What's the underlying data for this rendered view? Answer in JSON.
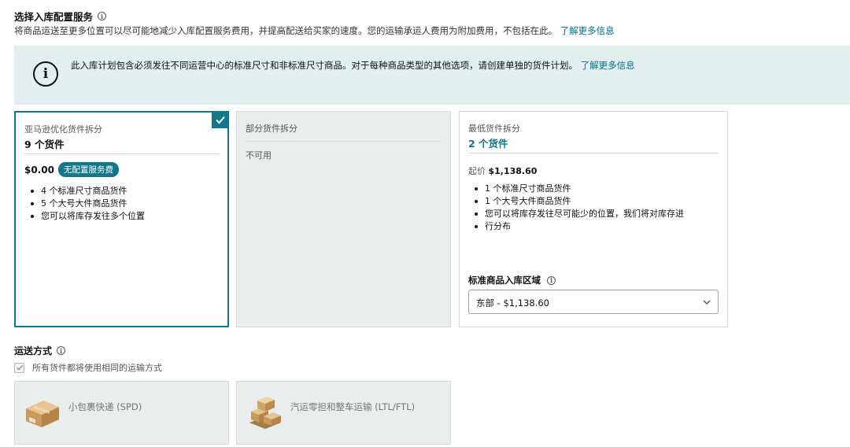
{
  "section": {
    "title": "选择入库配置服务",
    "description": "将商品运送至更多位置可以尽可能地减少入库配置服务费用，并提高配送给买家的速度。您的运输承运人费用为附加费用，不包括在此。",
    "learn_more": "了解更多信息"
  },
  "alert": {
    "text": "此入库计划包含必须发往不同运营中心的标准尺寸和非标准尺寸商品。对于每种商品类型的其他选项，请创建单独的货件计划。",
    "learn_more": "了解更多信息"
  },
  "options": [
    {
      "label": "亚马逊优化货件拆分",
      "value": "9 个货件",
      "price": "$0.00",
      "badge": "无配置服务费",
      "bullets": [
        "4 个标准尺寸商品货件",
        "5 个大号大件商品货件",
        "您可以将库存发往多个位置"
      ],
      "selected": true
    },
    {
      "label": "部分货件拆分",
      "status": "不可用"
    },
    {
      "label": "最低货件拆分",
      "value": "2 个货件",
      "starting_label": "起价",
      "starting_price": "$1,138.60",
      "bullets": [
        "1 个标准尺寸商品货件",
        "1 个大号大件商品货件",
        "您可以将库存发往尽可能少的位置，我们将对库存进",
        "行分布"
      ],
      "region_label": "标准商品入库区域",
      "region_value": "东部 - $1,138.60"
    }
  ],
  "shipping": {
    "title": "运送方式",
    "same_method_label": "所有货件都将使用相同的运输方式",
    "methods": [
      {
        "label": "小包裹快递 (SPD)",
        "icon": "box-icon"
      },
      {
        "label": "汽运零担和整车运输 (LTL/FTL)",
        "icon": "pallet-icon"
      }
    ]
  },
  "colors": {
    "accent": "#11788a",
    "link": "#007185",
    "alert_bg": "#e3eeee",
    "disabled_bg": "#eaeded"
  }
}
